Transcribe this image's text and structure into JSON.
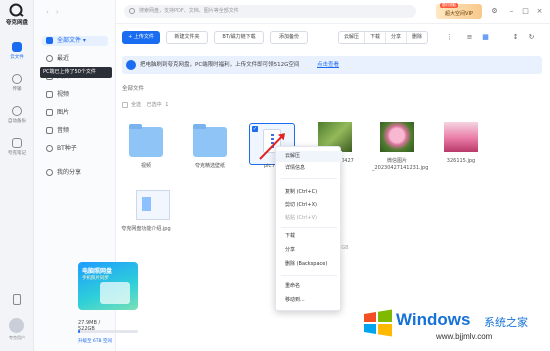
{
  "app": {
    "name": "夸克网盘"
  },
  "rail": {
    "items": [
      {
        "label": "云文件",
        "active": true
      },
      {
        "label": "传输"
      },
      {
        "label": "自动备份"
      },
      {
        "label": "夸克笔记"
      }
    ],
    "user": "夸克用户"
  },
  "tree": {
    "root": "全部文件",
    "items": [
      "最近",
      "文档",
      "视频",
      "图片",
      "音频",
      "BT种子",
      "我的分享"
    ],
    "tooltip": "PC端已上传了50个文件",
    "promo": {
      "title": "电脑照网盘",
      "sub": "手机照片同步"
    },
    "storage": {
      "text": "27.9MB / 522GB",
      "used_fraction": 0.04,
      "upgrade": "升级至 6TB 空间"
    }
  },
  "topbar": {
    "search_placeholder": "搜索网盘，支持PDF、文档、图片等全部文件",
    "vip_badge": "限时领取",
    "vip_label": "超大空间VIP",
    "icons": [
      "gear-icon",
      "minimize-icon",
      "maximize-icon",
      "close-icon"
    ]
  },
  "toolbar": {
    "upload": "+ 上传文件",
    "new_folder": "新建文件夹",
    "bt_download": "BT/磁力链下载",
    "add_backup": "添加备份",
    "seg": [
      "云解压",
      "下载",
      "分享",
      "删除"
    ],
    "more": "⋮"
  },
  "banner": {
    "text": "把电脑刷到夸克网盘，PC端限时福利，上传文件即可领512G空间",
    "link": "点击查看"
  },
  "breadcrumb": "全部文件",
  "selection": {
    "all_label": "全选",
    "count_label": "已选中",
    "count": "1"
  },
  "files": [
    {
      "name": "视频",
      "kind": "folder"
    },
    {
      "name": "夸克精选壁纸",
      "kind": "folder"
    },
    {
      "name": "pic.rar",
      "kind": "zip",
      "selected": true
    },
    {
      "name": "IMG_20230427",
      "kind": "photo-green"
    },
    {
      "name": "微信图片_20230427141231.jpg",
      "kind": "photo-flower"
    },
    {
      "name": "326115.jpg",
      "kind": "photo-pink"
    },
    {
      "name": "夸克网盘功能介绍.jpg",
      "kind": "doc"
    }
  ],
  "context_menu": {
    "items": [
      {
        "label": "云解压",
        "hover": true
      },
      {
        "label": "详情信息"
      },
      {
        "label": "复制 (Ctrl+C)"
      },
      {
        "label": "剪切 (Ctrl+X)"
      },
      {
        "label": "粘贴 (Ctrl+V)",
        "disabled": true
      },
      {
        "label": "下载"
      },
      {
        "label": "分享"
      },
      {
        "label": "删除 (Backspace)"
      },
      {
        "label": "重命名"
      },
      {
        "label": "移动到..."
      }
    ]
  },
  "behind_text": "已用/522GB",
  "watermark": {
    "title": "Windows",
    "cn": "系统之家",
    "url": "www.bjjmlv.com"
  }
}
